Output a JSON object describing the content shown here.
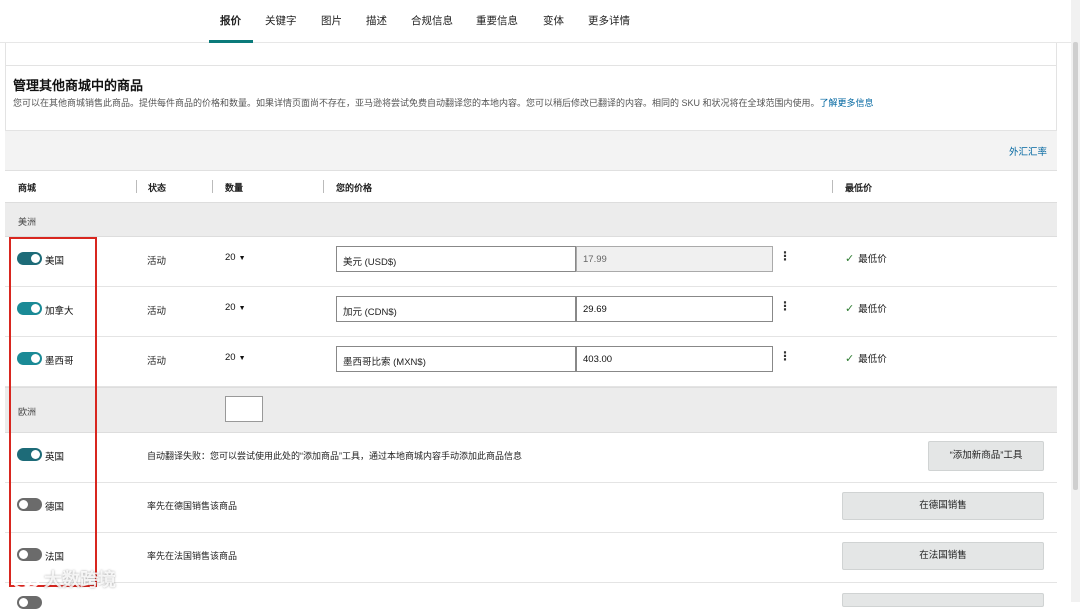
{
  "tabs": [
    {
      "label": "报价",
      "active": true
    },
    {
      "label": "关键字"
    },
    {
      "label": "图片"
    },
    {
      "label": "描述"
    },
    {
      "label": "合规信息"
    },
    {
      "label": "重要信息"
    },
    {
      "label": "变体"
    },
    {
      "label": "更多详情"
    }
  ],
  "section": {
    "title": "管理其他商城中的商品",
    "description": "您可以在其他商城销售此商品。提供每件商品的价格和数量。如果详情页面尚不存在，亚马逊将尝试免费自动翻译您的本地内容。您可以稍后修改已翻译的内容。相同的 SKU 和状况将在全球范围内使用。",
    "learn_more": "了解更多信息",
    "fx_link": "外汇汇率"
  },
  "columns": {
    "marketplace": "商城",
    "status": "状态",
    "quantity": "数量",
    "your_price": "您的价格",
    "lowest_price": "最低价"
  },
  "regions": {
    "americas": "美洲",
    "europe": "欧洲"
  },
  "americas_rows": [
    {
      "marketplace": "美国",
      "status": "活动",
      "quantity": "20",
      "currency": "美元 (USD$)",
      "price": "17.99",
      "lowest": "最低价",
      "toggle": "on-dark"
    },
    {
      "marketplace": "加拿大",
      "status": "活动",
      "quantity": "20",
      "currency": "加元 (CDN$)",
      "price": "29.69",
      "lowest": "最低价",
      "toggle": "on"
    },
    {
      "marketplace": "墨西哥",
      "status": "活动",
      "quantity": "20",
      "currency": "墨西哥比索 (MXN$)",
      "price": "403.00",
      "lowest": "最低价",
      "toggle": "on"
    }
  ],
  "europe_rows": [
    {
      "marketplace": "英国",
      "note": "自动翻译失败：您可以尝试使用此处的“添加商品”工具，通过本地商城内容手动添加此商品信息",
      "button": "“添加新商品”工具",
      "toggle": "on-dark"
    },
    {
      "marketplace": "德国",
      "note": "率先在德国销售该商品",
      "button": "在德国销售",
      "toggle": "off"
    },
    {
      "marketplace": "法国",
      "note": "率先在法国销售该商品",
      "button": "在法国销售",
      "toggle": "off"
    }
  ],
  "watermark": "大数跨境",
  "colors": {
    "accent": "#0a7a7a",
    "toggle_on": "#1a8a96",
    "highlight_frame": "#d8261f",
    "link": "#0066a0"
  }
}
